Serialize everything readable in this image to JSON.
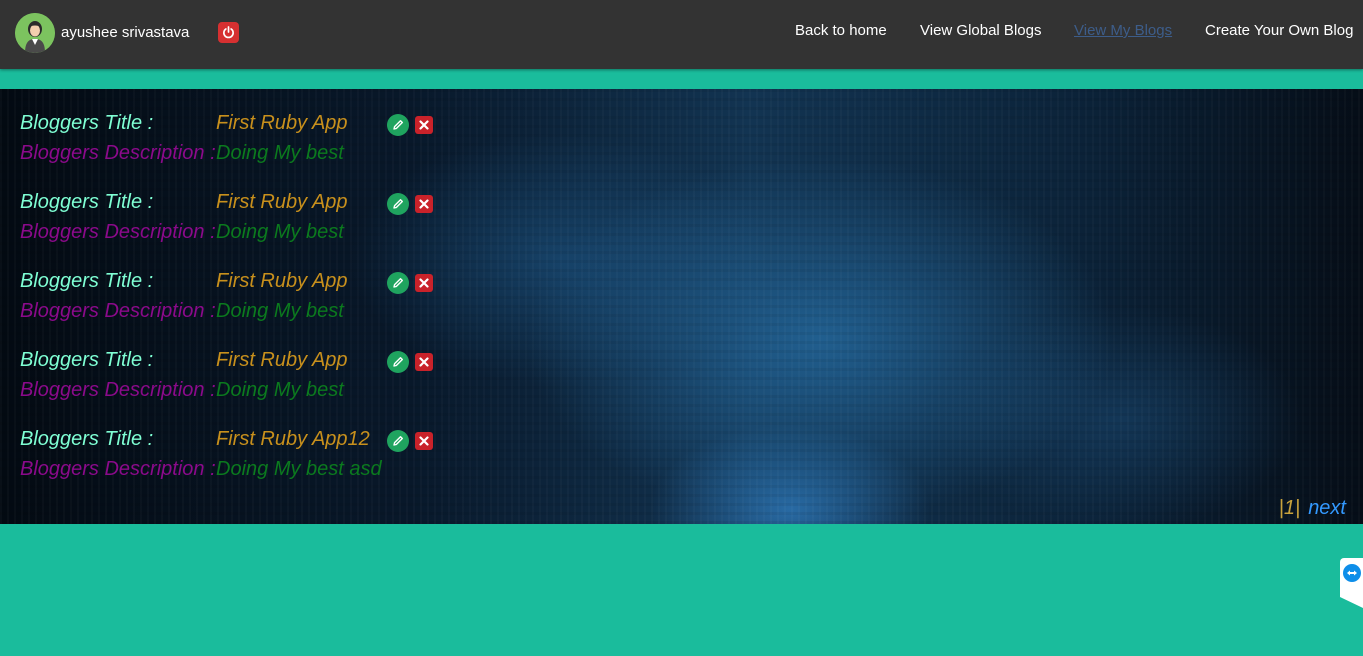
{
  "header": {
    "username": "ayushee srivastava",
    "nav": [
      {
        "label": "Back to home"
      },
      {
        "label": "View Global Blogs"
      },
      {
        "label": "View My Blogs"
      },
      {
        "label": "Create Your Own Blog"
      }
    ],
    "active_nav": "View My Blogs"
  },
  "blogs": [
    {
      "title_label": "Bloggers Title :",
      "title": "First Ruby App",
      "desc_label": "Bloggers Description :",
      "desc": "Doing My best"
    },
    {
      "title_label": "Bloggers Title :",
      "title": "First Ruby App",
      "desc_label": "Bloggers Description :",
      "desc": "Doing My best"
    },
    {
      "title_label": "Bloggers Title :",
      "title": "First Ruby App",
      "desc_label": "Bloggers Description :",
      "desc": "Doing My best"
    },
    {
      "title_label": "Bloggers Title :",
      "title": "First Ruby App",
      "desc_label": "Bloggers Description :",
      "desc": "Doing My best"
    },
    {
      "title_label": "Bloggers Title :",
      "title": "First Ruby App12",
      "desc_label": "Bloggers Description :",
      "desc": "Doing My best asd"
    }
  ],
  "pagination": {
    "current": "|1|",
    "next_label": "next"
  },
  "icons": {
    "power": "power-icon",
    "edit": "pencil-icon",
    "delete": "close-icon",
    "widget": "teamviewer-icon"
  },
  "colors": {
    "page_background": "#1abc9c",
    "navbar": "#333333",
    "title_label": "#7fffd4",
    "title_value": "#c8901c",
    "desc_label": "#8b0a8b",
    "desc_value": "#0b7a1e",
    "next_link": "#3399ff"
  }
}
